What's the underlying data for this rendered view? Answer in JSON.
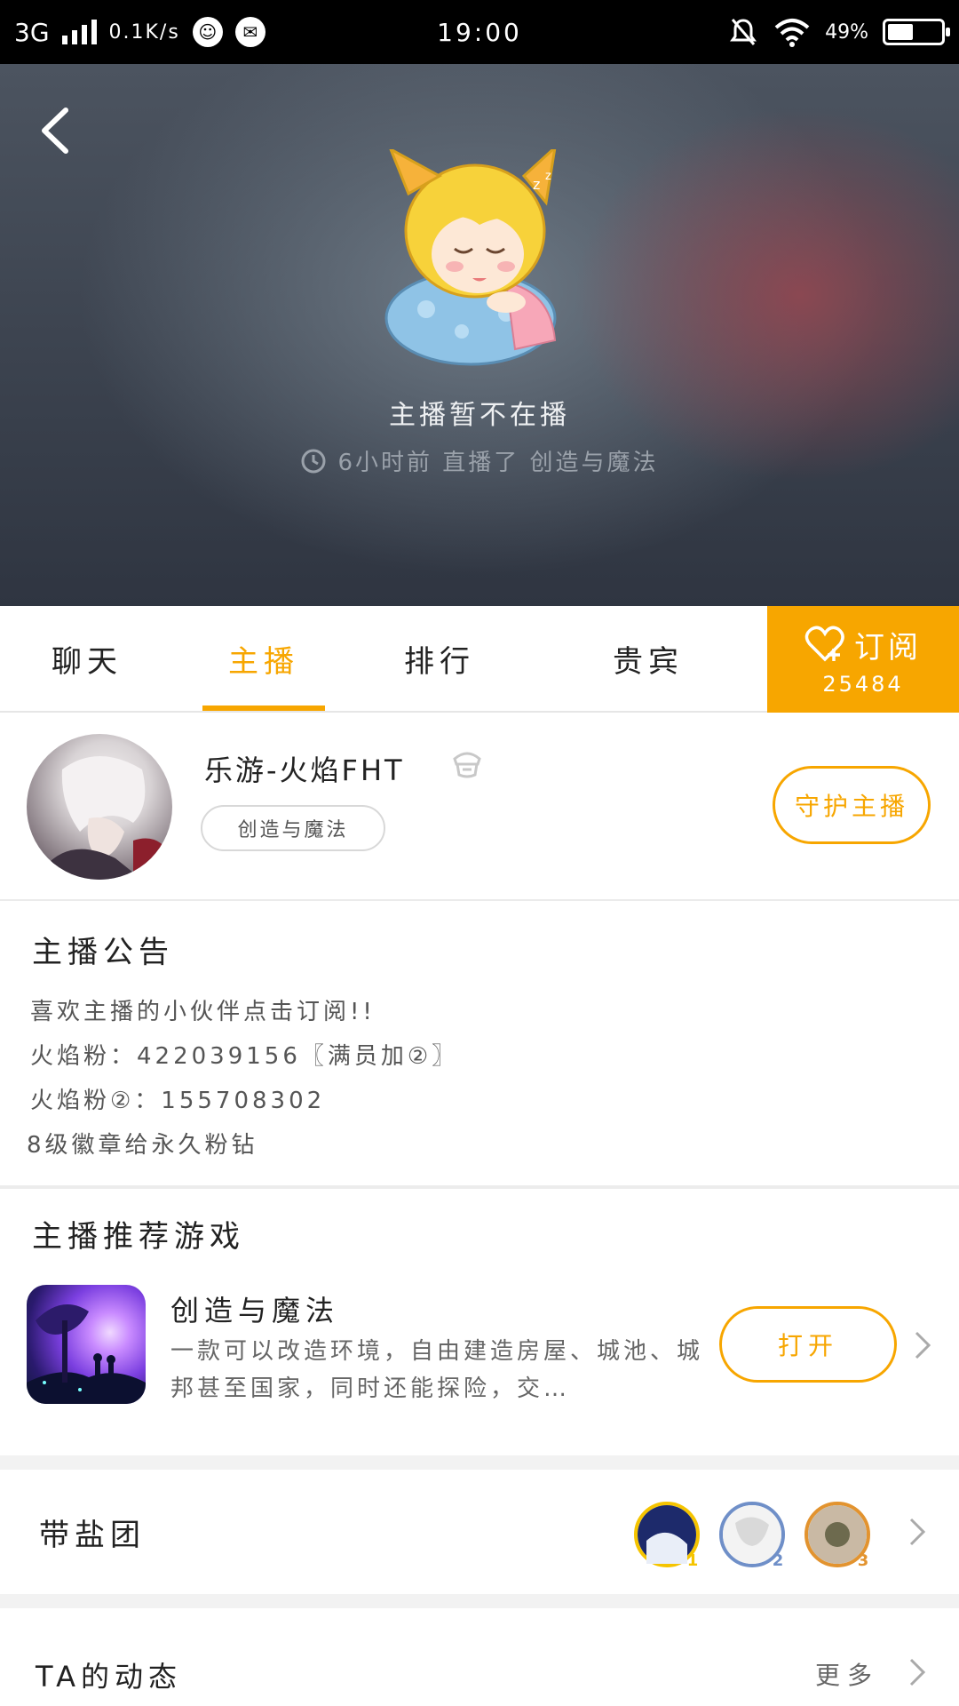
{
  "status_bar": {
    "network": "3G",
    "speed": "0.1K/s",
    "time": "19:00",
    "battery": "49%",
    "battery_level": 0.49
  },
  "hero": {
    "status": "主播暂不在播",
    "last_live": "6小时前 直播了 创造与魔法"
  },
  "tabs": [
    "聊天",
    "主播",
    "排行",
    "贵宾"
  ],
  "active_tab": 1,
  "subscribe": {
    "label": "订阅",
    "count": "25484"
  },
  "anchor": {
    "name": "乐游-火焰FHT",
    "game_tag": "创造与魔法",
    "guard_button": "守护主播"
  },
  "announcement": {
    "title": "主播公告",
    "lines": [
      "喜欢主播的小伙伴点击订阅!!",
      "火焰粉：422039156〖满员加②〗",
      "火焰粉②：155708302",
      "8级徽章给永久粉钻"
    ]
  },
  "recommend": {
    "title": "主播推荐游戏",
    "game_name": "创造与魔法",
    "game_desc": "一款可以改造环境，自由建造房屋、城池、城邦甚至国家，同时还能探险，交…",
    "open_button": "打开"
  },
  "salt_group": {
    "title": "带盐团",
    "fans": [
      {
        "rank": "1",
        "color": "#f5c400"
      },
      {
        "rank": "2",
        "color": "#6f8fc8"
      },
      {
        "rank": "3",
        "color": "#e2932f"
      }
    ]
  },
  "dynamics": {
    "title": "TA的动态",
    "more": "更多"
  },
  "colors": {
    "accent": "#f7a600"
  }
}
